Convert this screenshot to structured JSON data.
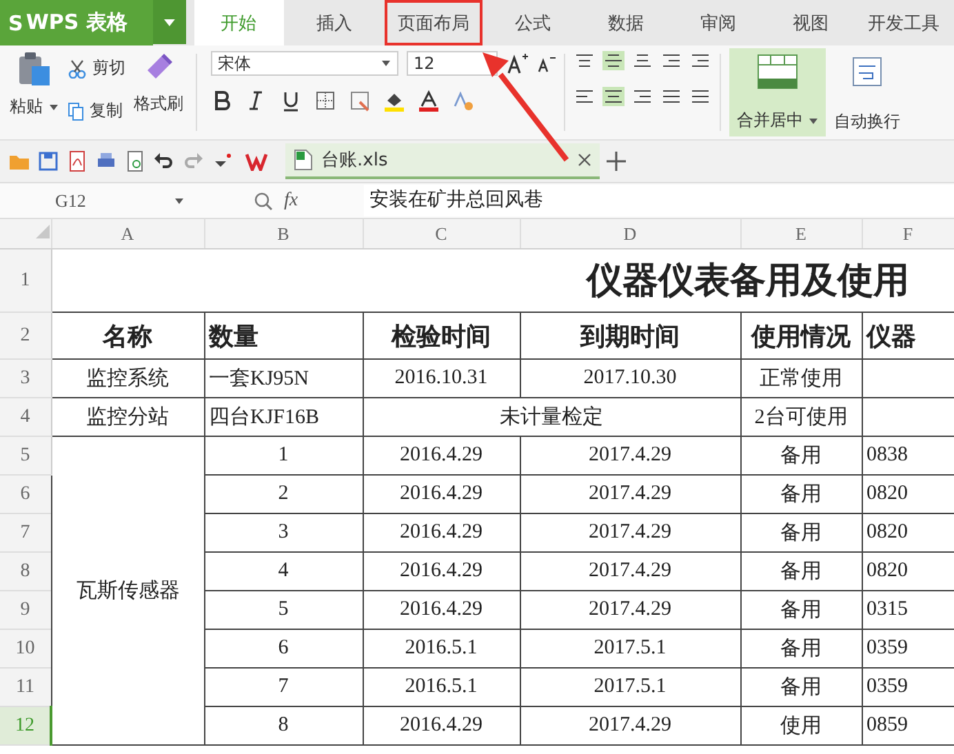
{
  "app": {
    "logo_mark": "S",
    "name": "WPS 表格"
  },
  "ribbon_tabs": [
    {
      "label": "开始",
      "selected": true,
      "annotated": false
    },
    {
      "label": "插入",
      "selected": false,
      "annotated": false
    },
    {
      "label": "页面布局",
      "selected": false,
      "annotated": true
    },
    {
      "label": "公式",
      "selected": false,
      "annotated": false
    },
    {
      "label": "数据",
      "selected": false,
      "annotated": false
    },
    {
      "label": "审阅",
      "selected": false,
      "annotated": false
    },
    {
      "label": "视图",
      "selected": false,
      "annotated": false
    },
    {
      "label": "开发工具",
      "selected": false,
      "annotated": false
    }
  ],
  "clipboard": {
    "paste": "粘贴",
    "cut": "剪切",
    "copy": "复制",
    "format_painter": "格式刷"
  },
  "font": {
    "name": "宋体",
    "size": "12"
  },
  "alignment": {
    "merge": "合并居中",
    "wrap": "自动换行"
  },
  "document_tab": {
    "title": "台账.xls"
  },
  "formula_bar": {
    "cell": "G12",
    "fx": "fx",
    "value": "安装在矿井总回风巷"
  },
  "sheet": {
    "columns": [
      "A",
      "B",
      "C",
      "D",
      "E",
      "F"
    ],
    "rows": [
      {
        "number": "1",
        "selected": false,
        "cells": [
          {
            "text": "仪器仪表备用及使用",
            "kind": "title",
            "colspan": 6
          }
        ]
      },
      {
        "number": "2",
        "selected": false,
        "cells": [
          {
            "text": "名称",
            "kind": "header"
          },
          {
            "text": "数量",
            "kind": "header-left"
          },
          {
            "text": "检验时间",
            "kind": "header"
          },
          {
            "text": "到期时间",
            "kind": "header"
          },
          {
            "text": "使用情况",
            "kind": "header"
          },
          {
            "text": "仪器",
            "kind": "header-left"
          }
        ]
      },
      {
        "number": "3",
        "selected": false,
        "cells": [
          {
            "text": "监控系统"
          },
          {
            "text": "一套KJ95N",
            "kind": "left"
          },
          {
            "text": "2016.10.31"
          },
          {
            "text": "2017.10.30"
          },
          {
            "text": "正常使用"
          },
          {
            "text": "",
            "kind": "empty"
          }
        ]
      },
      {
        "number": "4",
        "selected": false,
        "cells": [
          {
            "text": "监控分站"
          },
          {
            "text": "四台KJF16B",
            "kind": "left"
          },
          {
            "text": "未计量检定",
            "colspan": 2
          },
          {
            "text": "2台可使用"
          },
          {
            "text": "",
            "kind": "empty"
          }
        ]
      },
      {
        "number": "5",
        "selected": false,
        "cells": [
          {
            "text": "瓦斯传感器",
            "rowspan": 8
          },
          {
            "text": "1"
          },
          {
            "text": "2016.4.29"
          },
          {
            "text": "2017.4.29"
          },
          {
            "text": "备用"
          },
          {
            "text": "0838",
            "kind": "left"
          }
        ]
      },
      {
        "number": "6",
        "selected": false,
        "cells": [
          {
            "text": "2"
          },
          {
            "text": "2016.4.29"
          },
          {
            "text": "2017.4.29"
          },
          {
            "text": "备用"
          },
          {
            "text": "0820",
            "kind": "left"
          }
        ]
      },
      {
        "number": "7",
        "selected": false,
        "cells": [
          {
            "text": "3"
          },
          {
            "text": "2016.4.29"
          },
          {
            "text": "2017.4.29"
          },
          {
            "text": "备用"
          },
          {
            "text": "0820",
            "kind": "left"
          }
        ]
      },
      {
        "number": "8",
        "selected": false,
        "cells": [
          {
            "text": "4"
          },
          {
            "text": "2016.4.29"
          },
          {
            "text": "2017.4.29"
          },
          {
            "text": "备用"
          },
          {
            "text": "0820",
            "kind": "left"
          }
        ]
      },
      {
        "number": "9",
        "selected": false,
        "cells": [
          {
            "text": "5"
          },
          {
            "text": "2016.4.29"
          },
          {
            "text": "2017.4.29"
          },
          {
            "text": "备用"
          },
          {
            "text": "0315",
            "kind": "left"
          }
        ]
      },
      {
        "number": "10",
        "selected": false,
        "cells": [
          {
            "text": "6"
          },
          {
            "text": "2016.5.1"
          },
          {
            "text": "2017.5.1"
          },
          {
            "text": "备用"
          },
          {
            "text": "0359",
            "kind": "left"
          }
        ]
      },
      {
        "number": "11",
        "selected": false,
        "cells": [
          {
            "text": "7"
          },
          {
            "text": "2016.5.1"
          },
          {
            "text": "2017.5.1"
          },
          {
            "text": "备用"
          },
          {
            "text": "0359",
            "kind": "left"
          }
        ]
      },
      {
        "number": "12",
        "selected": true,
        "cells": [
          {
            "text": "8"
          },
          {
            "text": "2016.4.29"
          },
          {
            "text": "2017.4.29"
          },
          {
            "text": "使用"
          },
          {
            "text": "0859",
            "kind": "left"
          }
        ]
      }
    ]
  }
}
